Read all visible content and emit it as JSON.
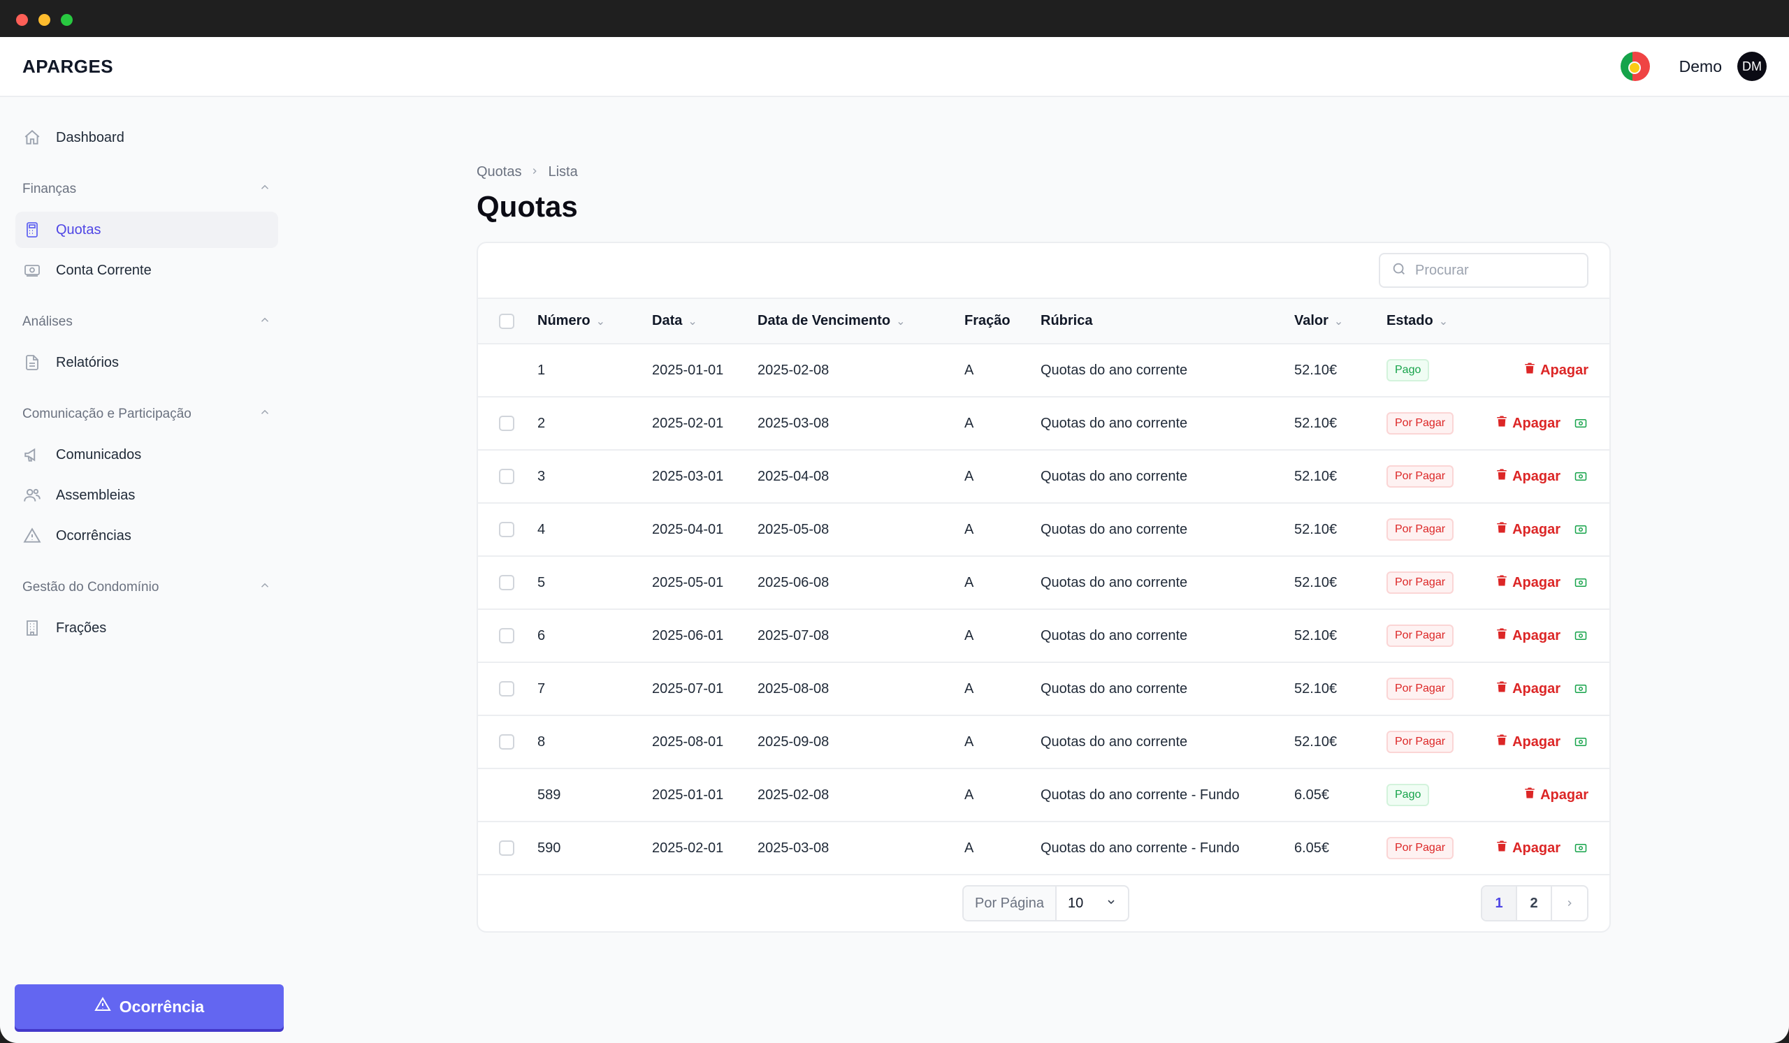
{
  "app": {
    "brand": "APARGES",
    "user": "Demo",
    "avatar_initials": "DM"
  },
  "sidebar": {
    "dashboard": "Dashboard",
    "sections": [
      {
        "title": "Finanças",
        "items": [
          "Quotas",
          "Conta Corrente"
        ]
      },
      {
        "title": "Análises",
        "items": [
          "Relatórios"
        ]
      },
      {
        "title": "Comunicação e Participação",
        "items": [
          "Comunicados",
          "Assembleias",
          "Ocorrências"
        ]
      },
      {
        "title": "Gestão do Condomínio",
        "items": [
          "Frações"
        ]
      }
    ],
    "report_button": "Ocorrência"
  },
  "breadcrumb": [
    "Quotas",
    "Lista"
  ],
  "page_title": "Quotas",
  "search": {
    "placeholder": "Procurar"
  },
  "table": {
    "headers": [
      "Número",
      "Data",
      "Data de Vencimento",
      "Fração",
      "Rúbrica",
      "Valor",
      "Estado"
    ],
    "delete_label": "Apagar",
    "rows": [
      {
        "numero": "1",
        "data": "2025-01-01",
        "vencimento": "2025-02-08",
        "fracao": "A",
        "rubrica": "Quotas do ano corrente",
        "valor": "52.10€",
        "estado": "Pago",
        "paid": true
      },
      {
        "numero": "2",
        "data": "2025-02-01",
        "vencimento": "2025-03-08",
        "fracao": "A",
        "rubrica": "Quotas do ano corrente",
        "valor": "52.10€",
        "estado": "Por Pagar",
        "paid": false
      },
      {
        "numero": "3",
        "data": "2025-03-01",
        "vencimento": "2025-04-08",
        "fracao": "A",
        "rubrica": "Quotas do ano corrente",
        "valor": "52.10€",
        "estado": "Por Pagar",
        "paid": false
      },
      {
        "numero": "4",
        "data": "2025-04-01",
        "vencimento": "2025-05-08",
        "fracao": "A",
        "rubrica": "Quotas do ano corrente",
        "valor": "52.10€",
        "estado": "Por Pagar",
        "paid": false
      },
      {
        "numero": "5",
        "data": "2025-05-01",
        "vencimento": "2025-06-08",
        "fracao": "A",
        "rubrica": "Quotas do ano corrente",
        "valor": "52.10€",
        "estado": "Por Pagar",
        "paid": false
      },
      {
        "numero": "6",
        "data": "2025-06-01",
        "vencimento": "2025-07-08",
        "fracao": "A",
        "rubrica": "Quotas do ano corrente",
        "valor": "52.10€",
        "estado": "Por Pagar",
        "paid": false
      },
      {
        "numero": "7",
        "data": "2025-07-01",
        "vencimento": "2025-08-08",
        "fracao": "A",
        "rubrica": "Quotas do ano corrente",
        "valor": "52.10€",
        "estado": "Por Pagar",
        "paid": false
      },
      {
        "numero": "8",
        "data": "2025-08-01",
        "vencimento": "2025-09-08",
        "fracao": "A",
        "rubrica": "Quotas do ano corrente",
        "valor": "52.10€",
        "estado": "Por Pagar",
        "paid": false
      },
      {
        "numero": "589",
        "data": "2025-01-01",
        "vencimento": "2025-02-08",
        "fracao": "A",
        "rubrica": "Quotas do ano corrente - Fundo",
        "valor": "6.05€",
        "estado": "Pago",
        "paid": true
      },
      {
        "numero": "590",
        "data": "2025-02-01",
        "vencimento": "2025-03-08",
        "fracao": "A",
        "rubrica": "Quotas do ano corrente - Fundo",
        "valor": "6.05€",
        "estado": "Por Pagar",
        "paid": false
      }
    ]
  },
  "pagination": {
    "per_page_label": "Por Página",
    "per_page_value": "10",
    "pages": [
      "1",
      "2"
    ],
    "current": "1"
  },
  "colors": {
    "accent": "#6366f1",
    "danger": "#dc2626",
    "success": "#16a34a"
  }
}
